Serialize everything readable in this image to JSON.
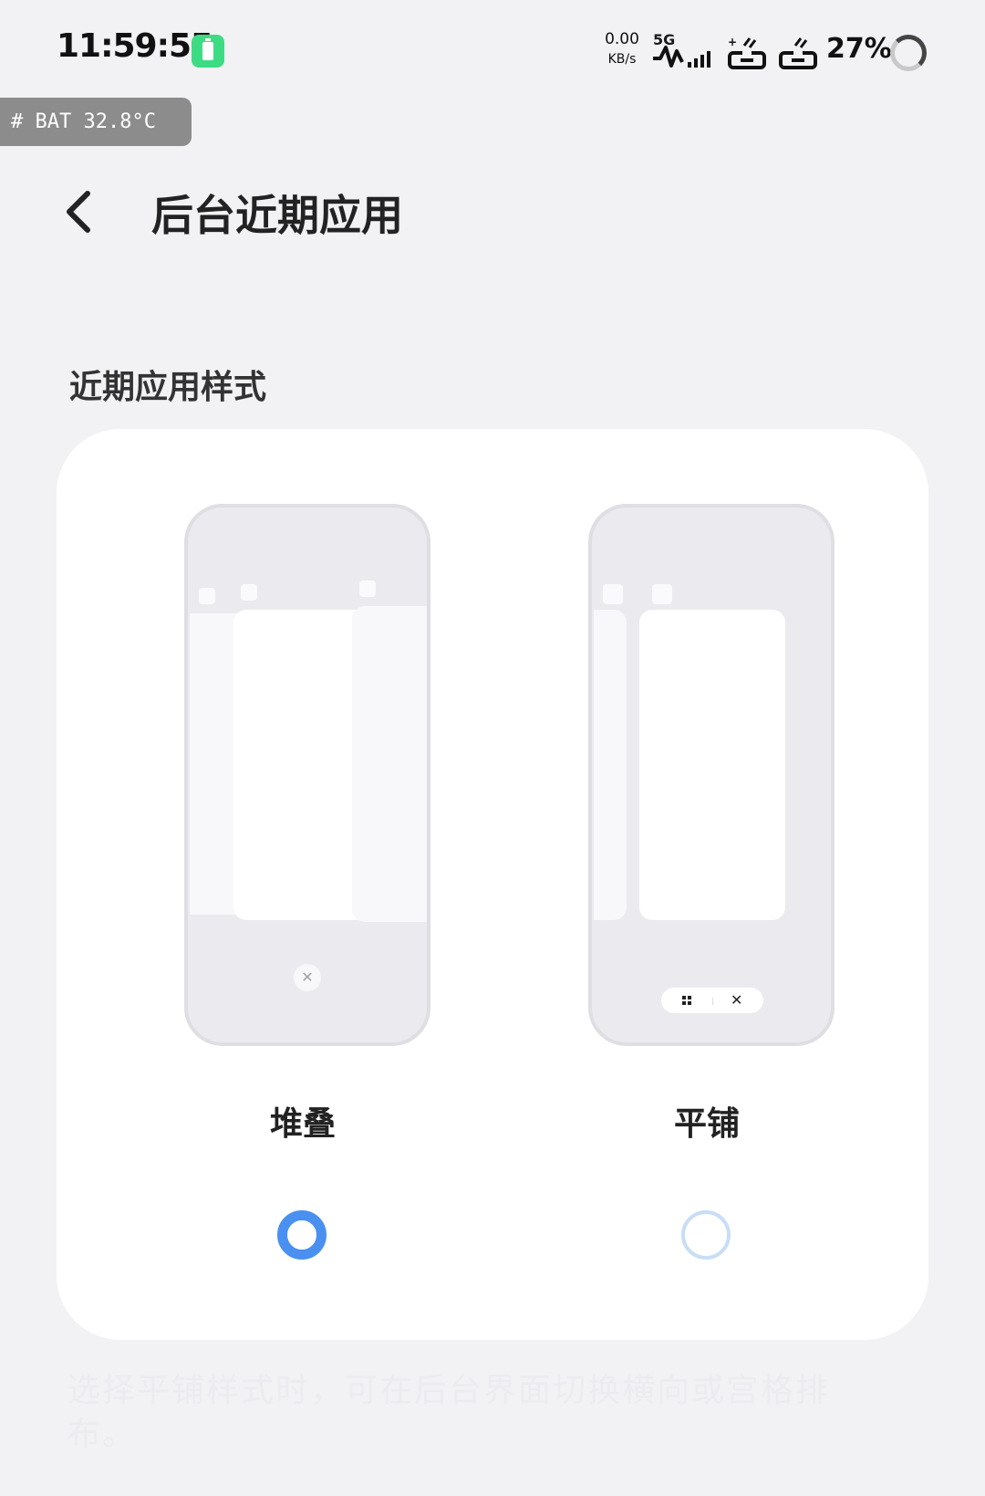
{
  "status_bar": {
    "time": "11:59:55",
    "net_speed_value": "0.00",
    "net_speed_unit": "KB/s",
    "network_type": "5G",
    "battery_percent": "27%"
  },
  "debug_overlay": {
    "text": "# BAT 32.8°C"
  },
  "header": {
    "title": "后台近期应用"
  },
  "section": {
    "title": "近期应用样式"
  },
  "options": [
    {
      "label": "堆叠",
      "selected": true
    },
    {
      "label": "平铺",
      "selected": false
    }
  ],
  "footnote": "选择平铺样式时，可在后台界面切换横向或宫格排布。",
  "colors": {
    "accent": "#4a90f0",
    "battery_badge": "#3ddc84",
    "page_background": "#f2f2f5"
  }
}
